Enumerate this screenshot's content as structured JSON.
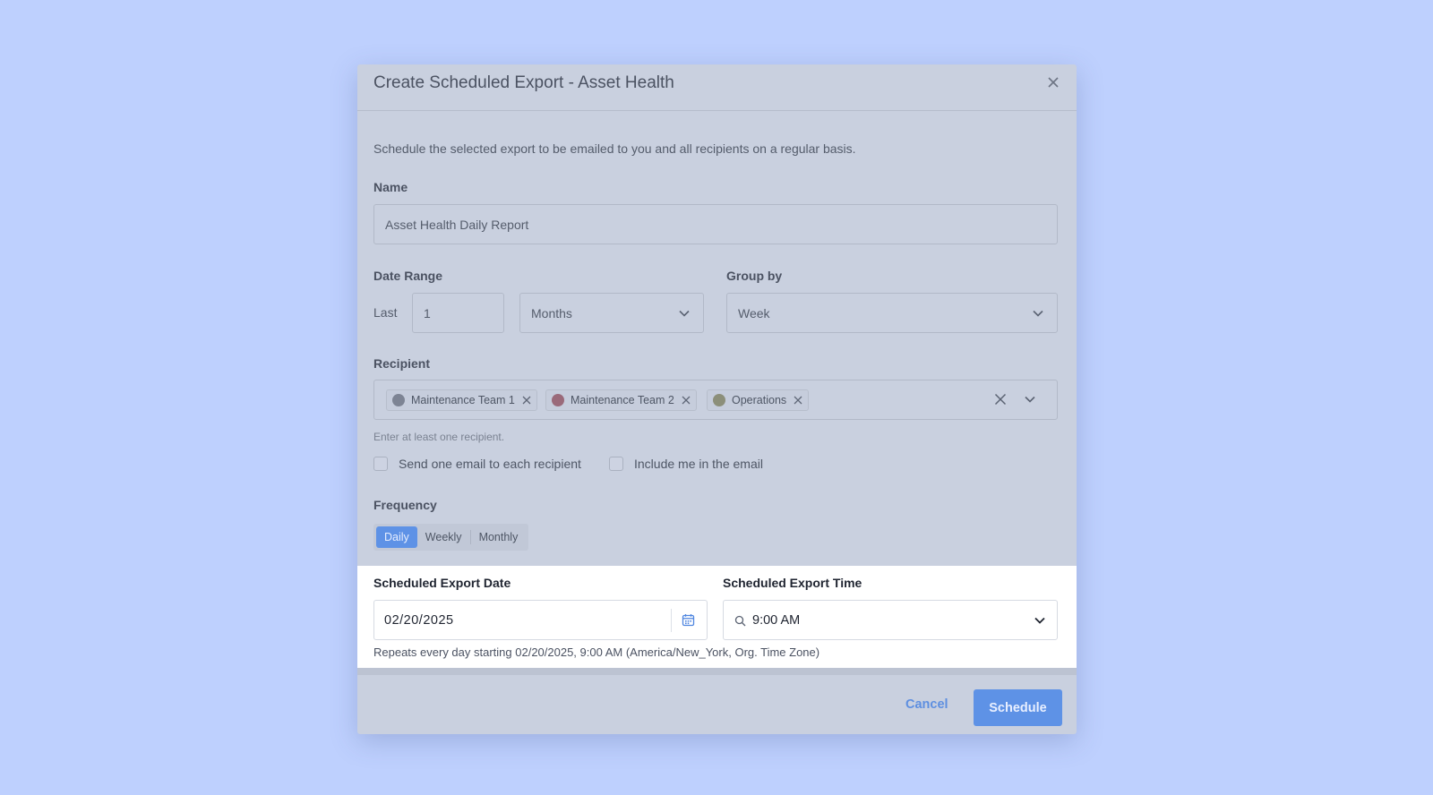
{
  "modal": {
    "title": "Create Scheduled Export - Asset Health",
    "description": "Schedule the selected export to be emailed to you and all recipients on a regular basis."
  },
  "name_field": {
    "label": "Name",
    "value": "Asset Health Daily Report"
  },
  "date_range": {
    "label": "Date Range",
    "prefix": "Last",
    "amount": "1",
    "unit": "Months"
  },
  "group_by": {
    "label": "Group by",
    "value": "Week"
  },
  "recipient": {
    "label": "Recipient",
    "chips": [
      {
        "label": "Maintenance Team 1",
        "color": "#7d8494"
      },
      {
        "label": "Maintenance Team 2",
        "color": "#9a6a7a"
      },
      {
        "label": "Operations",
        "color": "#8c8f7a"
      }
    ],
    "hint": "Enter at least one recipient."
  },
  "options": {
    "send_each": "Send one email to each recipient",
    "include_me": "Include me in the email"
  },
  "frequency": {
    "label": "Frequency",
    "tabs": [
      "Daily",
      "Weekly",
      "Monthly"
    ],
    "active": "Daily"
  },
  "schedule": {
    "date_label": "Scheduled Export Date",
    "date_value": "02/20/2025",
    "time_label": "Scheduled Export Time",
    "time_value": "9:00 AM",
    "note": "Repeats every day starting 02/20/2025, 9:00 AM (America/New_York, Org. Time Zone)"
  },
  "footer": {
    "cancel": "Cancel",
    "schedule": "Schedule"
  },
  "colors": {
    "background": "#bed0fe",
    "accent": "#5e92e6"
  }
}
